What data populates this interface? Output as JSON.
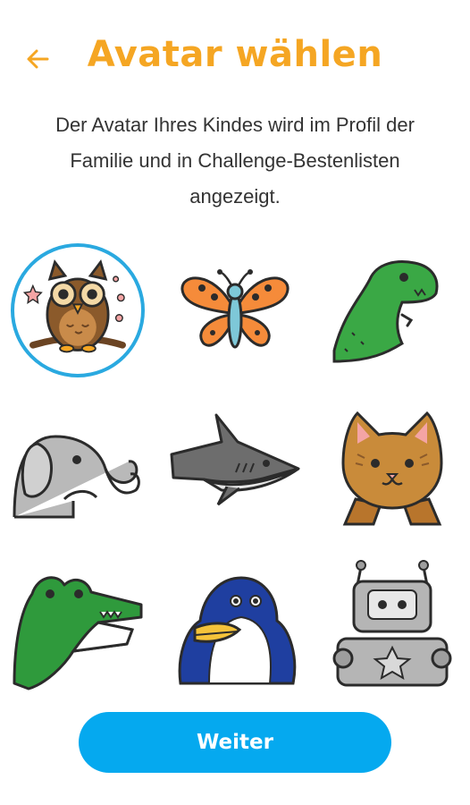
{
  "header": {
    "title": "Avatar wählen",
    "back_icon": "arrow-left-icon"
  },
  "description": "Der Avatar Ihres Kindes wird im Profil der Familie und in Challenge-Bestenlisten angezeigt.",
  "avatars": [
    {
      "name": "owl",
      "selected": true
    },
    {
      "name": "butterfly",
      "selected": false
    },
    {
      "name": "dinosaur",
      "selected": false
    },
    {
      "name": "elephant",
      "selected": false
    },
    {
      "name": "shark",
      "selected": false
    },
    {
      "name": "cat",
      "selected": false
    },
    {
      "name": "crocodile",
      "selected": false
    },
    {
      "name": "penguin",
      "selected": false
    },
    {
      "name": "robot",
      "selected": false
    }
  ],
  "primary_button": {
    "label": "Weiter"
  },
  "colors": {
    "title": "#f5a623",
    "accent": "#05a9ef",
    "selected_ring": "#2aa9e0",
    "text": "#333333"
  }
}
